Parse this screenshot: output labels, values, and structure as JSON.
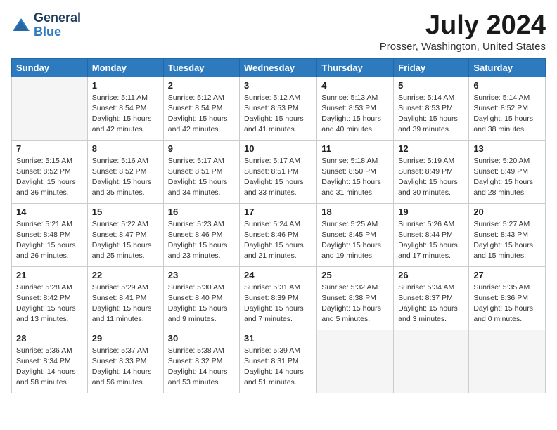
{
  "logo": {
    "general": "General",
    "blue": "Blue"
  },
  "title": "July 2024",
  "location": "Prosser, Washington, United States",
  "days_of_week": [
    "Sunday",
    "Monday",
    "Tuesday",
    "Wednesday",
    "Thursday",
    "Friday",
    "Saturday"
  ],
  "weeks": [
    [
      {
        "day": "",
        "info": ""
      },
      {
        "day": "1",
        "info": "Sunrise: 5:11 AM\nSunset: 8:54 PM\nDaylight: 15 hours\nand 42 minutes."
      },
      {
        "day": "2",
        "info": "Sunrise: 5:12 AM\nSunset: 8:54 PM\nDaylight: 15 hours\nand 42 minutes."
      },
      {
        "day": "3",
        "info": "Sunrise: 5:12 AM\nSunset: 8:53 PM\nDaylight: 15 hours\nand 41 minutes."
      },
      {
        "day": "4",
        "info": "Sunrise: 5:13 AM\nSunset: 8:53 PM\nDaylight: 15 hours\nand 40 minutes."
      },
      {
        "day": "5",
        "info": "Sunrise: 5:14 AM\nSunset: 8:53 PM\nDaylight: 15 hours\nand 39 minutes."
      },
      {
        "day": "6",
        "info": "Sunrise: 5:14 AM\nSunset: 8:52 PM\nDaylight: 15 hours\nand 38 minutes."
      }
    ],
    [
      {
        "day": "7",
        "info": "Sunrise: 5:15 AM\nSunset: 8:52 PM\nDaylight: 15 hours\nand 36 minutes."
      },
      {
        "day": "8",
        "info": "Sunrise: 5:16 AM\nSunset: 8:52 PM\nDaylight: 15 hours\nand 35 minutes."
      },
      {
        "day": "9",
        "info": "Sunrise: 5:17 AM\nSunset: 8:51 PM\nDaylight: 15 hours\nand 34 minutes."
      },
      {
        "day": "10",
        "info": "Sunrise: 5:17 AM\nSunset: 8:51 PM\nDaylight: 15 hours\nand 33 minutes."
      },
      {
        "day": "11",
        "info": "Sunrise: 5:18 AM\nSunset: 8:50 PM\nDaylight: 15 hours\nand 31 minutes."
      },
      {
        "day": "12",
        "info": "Sunrise: 5:19 AM\nSunset: 8:49 PM\nDaylight: 15 hours\nand 30 minutes."
      },
      {
        "day": "13",
        "info": "Sunrise: 5:20 AM\nSunset: 8:49 PM\nDaylight: 15 hours\nand 28 minutes."
      }
    ],
    [
      {
        "day": "14",
        "info": "Sunrise: 5:21 AM\nSunset: 8:48 PM\nDaylight: 15 hours\nand 26 minutes."
      },
      {
        "day": "15",
        "info": "Sunrise: 5:22 AM\nSunset: 8:47 PM\nDaylight: 15 hours\nand 25 minutes."
      },
      {
        "day": "16",
        "info": "Sunrise: 5:23 AM\nSunset: 8:46 PM\nDaylight: 15 hours\nand 23 minutes."
      },
      {
        "day": "17",
        "info": "Sunrise: 5:24 AM\nSunset: 8:46 PM\nDaylight: 15 hours\nand 21 minutes."
      },
      {
        "day": "18",
        "info": "Sunrise: 5:25 AM\nSunset: 8:45 PM\nDaylight: 15 hours\nand 19 minutes."
      },
      {
        "day": "19",
        "info": "Sunrise: 5:26 AM\nSunset: 8:44 PM\nDaylight: 15 hours\nand 17 minutes."
      },
      {
        "day": "20",
        "info": "Sunrise: 5:27 AM\nSunset: 8:43 PM\nDaylight: 15 hours\nand 15 minutes."
      }
    ],
    [
      {
        "day": "21",
        "info": "Sunrise: 5:28 AM\nSunset: 8:42 PM\nDaylight: 15 hours\nand 13 minutes."
      },
      {
        "day": "22",
        "info": "Sunrise: 5:29 AM\nSunset: 8:41 PM\nDaylight: 15 hours\nand 11 minutes."
      },
      {
        "day": "23",
        "info": "Sunrise: 5:30 AM\nSunset: 8:40 PM\nDaylight: 15 hours\nand 9 minutes."
      },
      {
        "day": "24",
        "info": "Sunrise: 5:31 AM\nSunset: 8:39 PM\nDaylight: 15 hours\nand 7 minutes."
      },
      {
        "day": "25",
        "info": "Sunrise: 5:32 AM\nSunset: 8:38 PM\nDaylight: 15 hours\nand 5 minutes."
      },
      {
        "day": "26",
        "info": "Sunrise: 5:34 AM\nSunset: 8:37 PM\nDaylight: 15 hours\nand 3 minutes."
      },
      {
        "day": "27",
        "info": "Sunrise: 5:35 AM\nSunset: 8:36 PM\nDaylight: 15 hours\nand 0 minutes."
      }
    ],
    [
      {
        "day": "28",
        "info": "Sunrise: 5:36 AM\nSunset: 8:34 PM\nDaylight: 14 hours\nand 58 minutes."
      },
      {
        "day": "29",
        "info": "Sunrise: 5:37 AM\nSunset: 8:33 PM\nDaylight: 14 hours\nand 56 minutes."
      },
      {
        "day": "30",
        "info": "Sunrise: 5:38 AM\nSunset: 8:32 PM\nDaylight: 14 hours\nand 53 minutes."
      },
      {
        "day": "31",
        "info": "Sunrise: 5:39 AM\nSunset: 8:31 PM\nDaylight: 14 hours\nand 51 minutes."
      },
      {
        "day": "",
        "info": ""
      },
      {
        "day": "",
        "info": ""
      },
      {
        "day": "",
        "info": ""
      }
    ]
  ]
}
